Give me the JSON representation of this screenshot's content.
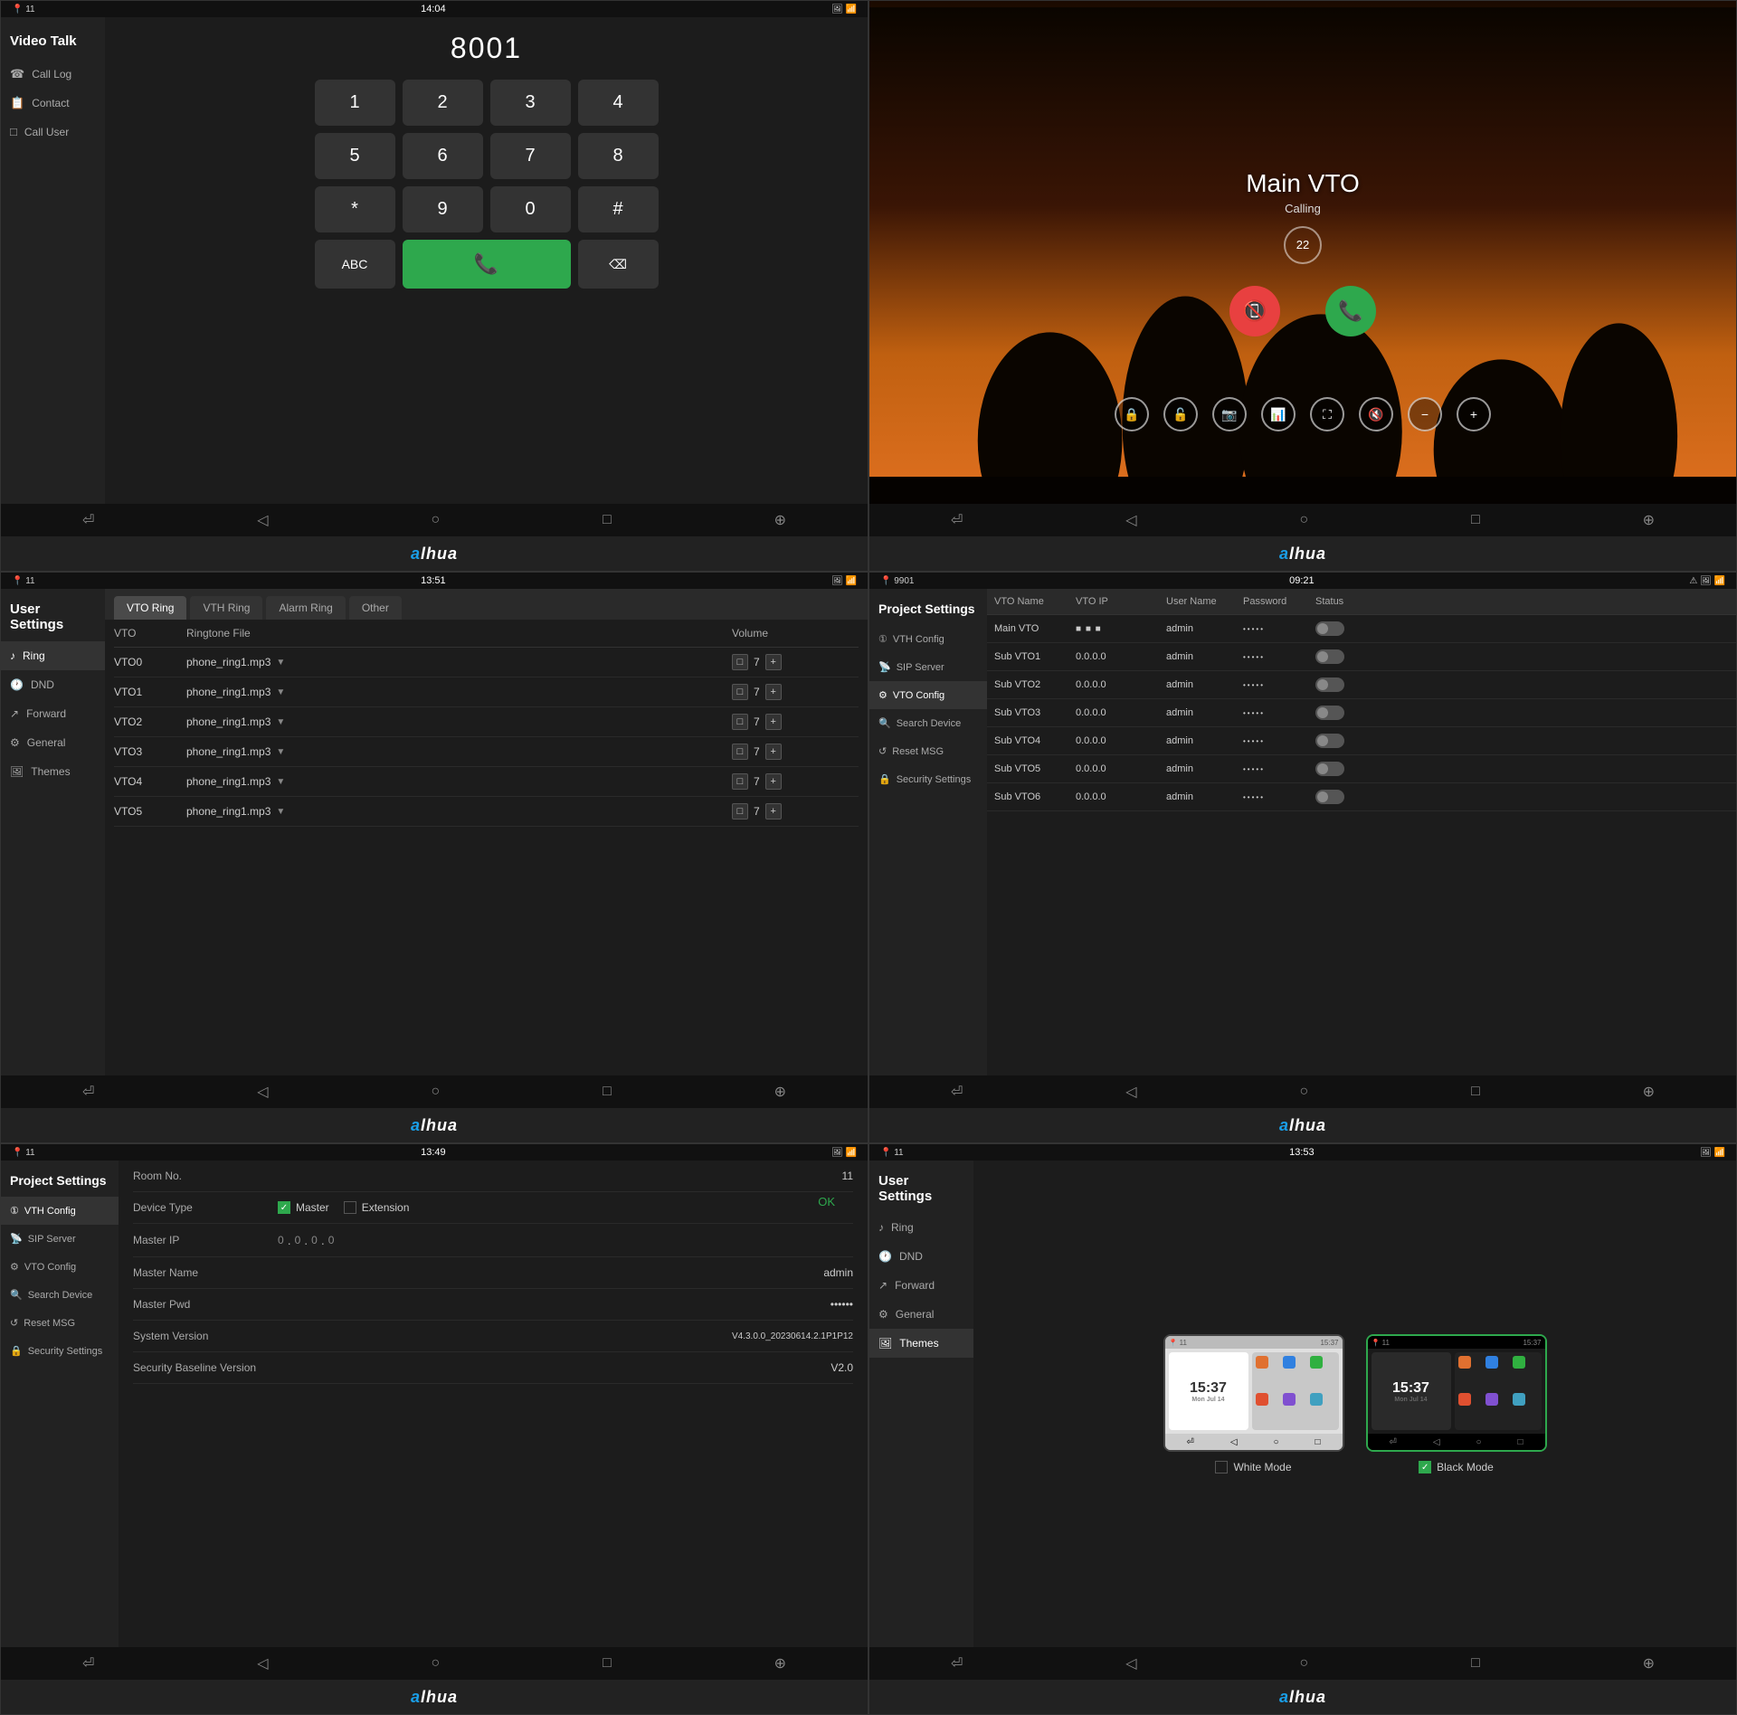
{
  "brand": "ahua",
  "panels": {
    "panel1": {
      "title": "Video Talk",
      "time": "14:04",
      "signal": "11",
      "dialer_display": "8001",
      "sidebar_items": [
        {
          "label": "Call Log",
          "icon": "☎"
        },
        {
          "label": "Contact",
          "icon": "📋"
        },
        {
          "label": "Call User",
          "icon": "📞"
        }
      ],
      "keys": [
        "1",
        "2",
        "3",
        "4",
        "5",
        "6",
        "7",
        "8",
        "*",
        "9",
        "0",
        "#",
        "ABC",
        "",
        "⌫"
      ],
      "nav": [
        "⏎",
        "◁",
        "○",
        "□",
        "⊕"
      ]
    },
    "panel2": {
      "call_name": "Main VTO",
      "call_status": "Calling",
      "call_timer": "22",
      "action_icons": [
        "🔒",
        "🔓",
        "📷",
        "📊",
        "⛶",
        "🔇",
        "−",
        "+"
      ]
    },
    "panel3": {
      "title": "User Settings",
      "time": "13:51",
      "signal": "11",
      "tabs": [
        "VTO Ring",
        "VTH Ring",
        "Alarm Ring",
        "Other"
      ],
      "active_tab": "VTO Ring",
      "sidebar": [
        {
          "label": "Ring",
          "icon": "♪",
          "active": true
        },
        {
          "label": "DND",
          "icon": "🕐"
        },
        {
          "label": "Forward",
          "icon": "↗"
        },
        {
          "label": "General",
          "icon": "⚙"
        },
        {
          "label": "Themes",
          "icon": "🖼"
        }
      ],
      "table_headers": [
        "VTO",
        "Ringtone File",
        "Volume"
      ],
      "rows": [
        {
          "vto": "VTO0",
          "file": "phone_ring1.mp3",
          "volume": "7"
        },
        {
          "vto": "VTO1",
          "file": "phone_ring1.mp3",
          "volume": "7"
        },
        {
          "vto": "VTO2",
          "file": "phone_ring1.mp3",
          "volume": "7"
        },
        {
          "vto": "VTO3",
          "file": "phone_ring1.mp3",
          "volume": "7"
        },
        {
          "vto": "VTO4",
          "file": "phone_ring1.mp3",
          "volume": "7"
        },
        {
          "vto": "VTO5",
          "file": "phone_ring1.mp3",
          "volume": "7"
        }
      ]
    },
    "panel4": {
      "title": "Project Settings",
      "time": "09:21",
      "signal": "9901",
      "sidebar": [
        {
          "label": "VTH Config",
          "icon": "①"
        },
        {
          "label": "SIP Server",
          "icon": "📡"
        },
        {
          "label": "VTO Config",
          "icon": "⚙",
          "active": true
        },
        {
          "label": "Search Device",
          "icon": "🔍"
        },
        {
          "label": "Reset MSG",
          "icon": "↺"
        },
        {
          "label": "Security Settings",
          "icon": "🔒"
        }
      ],
      "table_headers": [
        "VTO Name",
        "VTO IP",
        "User Name",
        "Password",
        "Status"
      ],
      "rows": [
        {
          "name": "Main VTO",
          "ip": "■ ■ ■",
          "user": "admin",
          "pwd": "•••••",
          "status": false
        },
        {
          "name": "Sub VTO1",
          "ip": "0.0.0.0",
          "user": "admin",
          "pwd": "•••••",
          "status": false
        },
        {
          "name": "Sub VTO2",
          "ip": "0.0.0.0",
          "user": "admin",
          "pwd": "•••••",
          "status": false
        },
        {
          "name": "Sub VTO3",
          "ip": "0.0.0.0",
          "user": "admin",
          "pwd": "•••••",
          "status": false
        },
        {
          "name": "Sub VTO4",
          "ip": "0.0.0.0",
          "user": "admin",
          "pwd": "•••••",
          "status": false
        },
        {
          "name": "Sub VTO5",
          "ip": "0.0.0.0",
          "user": "admin",
          "pwd": "•••••",
          "status": false
        },
        {
          "name": "Sub VTO6",
          "ip": "0.0.0.0",
          "user": "admin",
          "pwd": "•••••",
          "status": false
        }
      ]
    },
    "panel5": {
      "title": "Project Settings",
      "time": "13:49",
      "signal": "11",
      "ok_label": "OK",
      "sidebar": [
        {
          "label": "VTH Config",
          "icon": "①",
          "active": true
        },
        {
          "label": "SIP Server",
          "icon": "📡"
        },
        {
          "label": "VTO Config",
          "icon": "⚙"
        },
        {
          "label": "Search Device",
          "icon": "🔍"
        },
        {
          "label": "Reset MSG",
          "icon": "↺"
        },
        {
          "label": "Security Settings",
          "icon": "🔒"
        }
      ],
      "fields": [
        {
          "label": "Room No.",
          "value": "11"
        },
        {
          "label": "Device Type",
          "value": ""
        },
        {
          "label": "Master IP",
          "value": "0 . 0 . 0 . 0"
        },
        {
          "label": "Master Name",
          "value": "admin"
        },
        {
          "label": "Master Pwd",
          "value": "••••••"
        },
        {
          "label": "System Version",
          "value": "V4.3.0.0_20230614.2.1P1P12"
        },
        {
          "label": "Security Baseline Version",
          "value": "V2.0"
        }
      ],
      "device_types": [
        {
          "label": "Master",
          "checked": true
        },
        {
          "label": "Extension",
          "checked": false
        }
      ]
    },
    "panel6": {
      "title": "User Settings",
      "time": "13:53",
      "signal": "11",
      "sidebar": [
        {
          "label": "Ring",
          "icon": "♪"
        },
        {
          "label": "DND",
          "icon": "🕐"
        },
        {
          "label": "Forward",
          "icon": "↗"
        },
        {
          "label": "General",
          "icon": "⚙"
        },
        {
          "label": "Themes",
          "icon": "🖼",
          "active": true
        }
      ],
      "themes": [
        {
          "label": "White Mode",
          "checked": false,
          "type": "white",
          "clock": "15:37"
        },
        {
          "label": "Black Mode",
          "checked": true,
          "type": "black",
          "clock": "15:37"
        }
      ]
    }
  }
}
